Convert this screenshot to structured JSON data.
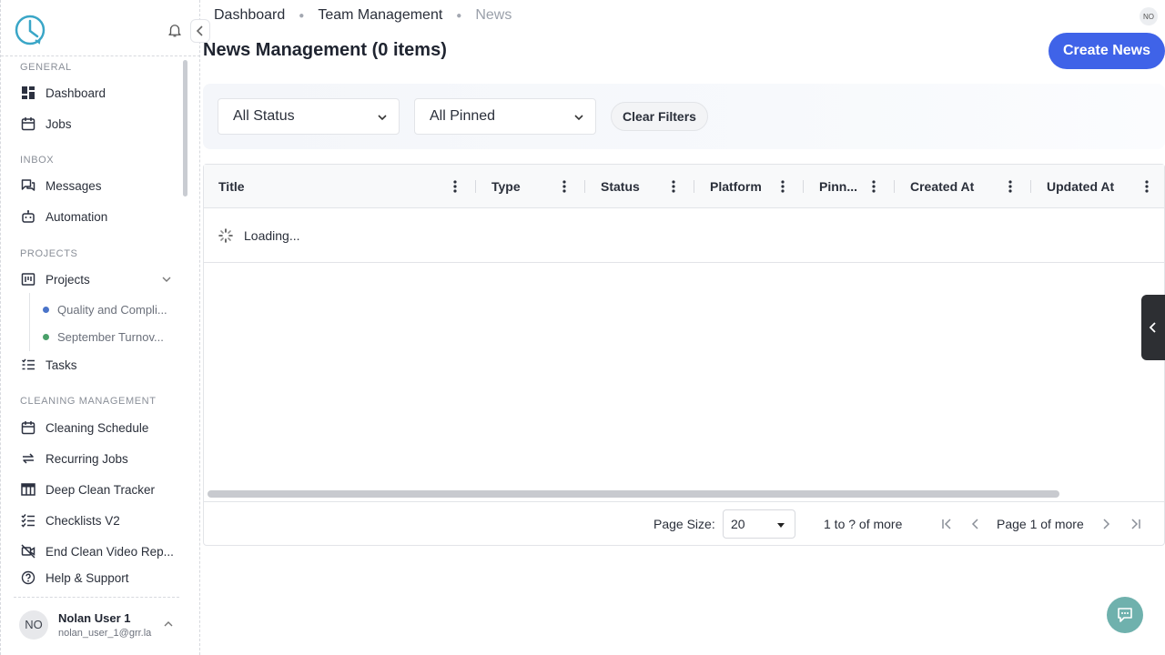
{
  "sidebar": {
    "sections": {
      "general": "GENERAL",
      "inbox": "INBOX",
      "projects": "PROJECTS",
      "cleaning": "CLEANING MANAGEMENT"
    },
    "items": {
      "dashboard": "Dashboard",
      "jobs": "Jobs",
      "messages": "Messages",
      "automation": "Automation",
      "projects": "Projects",
      "tasks": "Tasks",
      "cleaning_schedule": "Cleaning Schedule",
      "recurring_jobs": "Recurring Jobs",
      "deep_clean_tracker": "Deep Clean Tracker",
      "checklists_v2": "Checklists V2",
      "end_clean_video": "End Clean Video Rep...",
      "help_support": "Help & Support"
    },
    "sub_projects": [
      {
        "label": "Quality and Compli...",
        "color": "#4a74c9"
      },
      {
        "label": "September Turnov...",
        "color": "#4aa06a"
      }
    ],
    "user": {
      "initials": "NO",
      "name": "Nolan User 1",
      "email": "nolan_user_1@grr.la"
    }
  },
  "header": {
    "breadcrumb": [
      "Dashboard",
      "Team Management",
      "News"
    ],
    "avatar_initials": "NO",
    "title": "News Management (0 items)",
    "create_button": "Create News"
  },
  "filters": {
    "status": "All Status",
    "pinned": "All Pinned",
    "clear": "Clear Filters"
  },
  "grid": {
    "columns": [
      "Title",
      "Type",
      "Status",
      "Platform",
      "Pinn...",
      "Created At",
      "Updated At"
    ],
    "loading_text": "Loading...",
    "footer": {
      "page_size_label": "Page Size:",
      "page_size_value": "20",
      "range": "1 to ? of more",
      "page_info": "Page 1 of more"
    }
  },
  "colors": {
    "accent": "#3f63e8",
    "chat_fab": "#6fb1ad",
    "logo": "#3aa6c7"
  }
}
